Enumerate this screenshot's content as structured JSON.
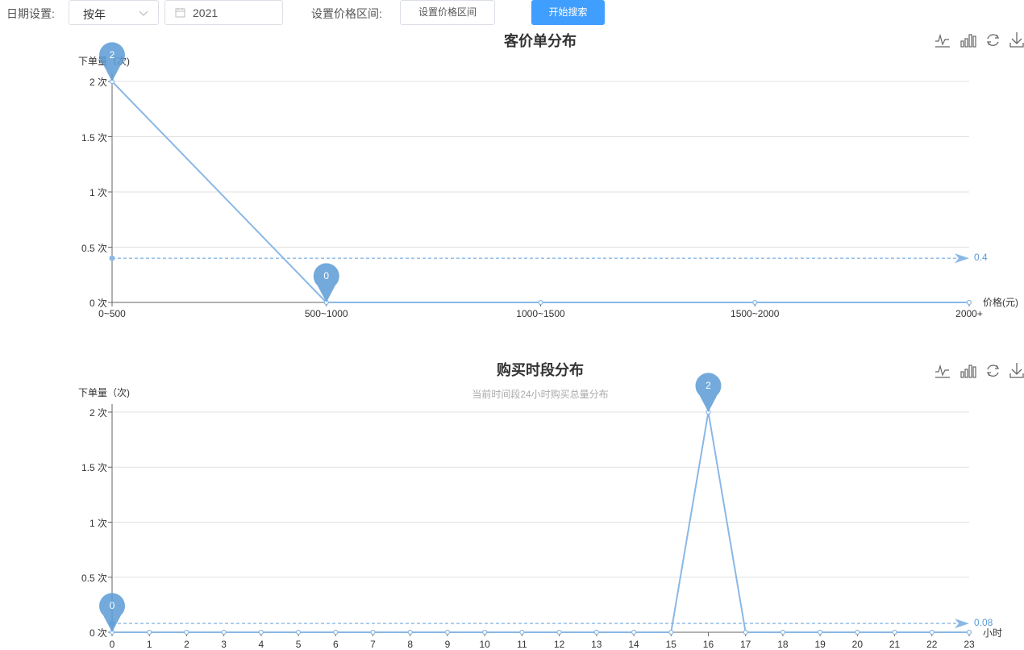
{
  "filters": {
    "date_label": "日期设置:",
    "date_mode": "按年",
    "year": "2021",
    "range_label": "设置价格区间:",
    "range_button": "设置价格区间",
    "search_button": "开始搜索"
  },
  "toolbox": {
    "icons": [
      "line-chart-icon",
      "bar-chart-icon",
      "refresh-icon",
      "download-icon"
    ]
  },
  "colors": {
    "series": "#8ab8e6",
    "marker": "#5b9bd5",
    "primary_button": "#409eff"
  },
  "chart_data": [
    {
      "type": "line",
      "title": "客价单分布",
      "subtitle": "",
      "ylabel": "下单量（次)",
      "xlabel": "价格(元)",
      "categories": [
        "0~500",
        "500~1000",
        "1000~1500",
        "1500~2000",
        "2000+"
      ],
      "values": [
        2,
        0,
        0,
        0,
        0
      ],
      "ylim": [
        0,
        2
      ],
      "y_ticks": [
        "0 次",
        "0.5 次",
        "1 次",
        "1.5 次",
        "2 次"
      ],
      "mark_points": [
        {
          "label": "2",
          "category": "0~500",
          "value": 2
        },
        {
          "label": "0",
          "category": "500~1000",
          "value": 0
        }
      ],
      "mark_line": {
        "label": "0.4",
        "value": 0.4
      },
      "grid": true
    },
    {
      "type": "line",
      "title": "购买时段分布",
      "subtitle": "当前时间段24小时购买总量分布",
      "ylabel": "下单量（次)",
      "xlabel": "小时",
      "categories": [
        "0",
        "1",
        "2",
        "3",
        "4",
        "5",
        "6",
        "7",
        "8",
        "9",
        "10",
        "11",
        "12",
        "13",
        "14",
        "15",
        "16",
        "17",
        "18",
        "19",
        "20",
        "21",
        "22",
        "23"
      ],
      "values": [
        0,
        0,
        0,
        0,
        0,
        0,
        0,
        0,
        0,
        0,
        0,
        0,
        0,
        0,
        0,
        0,
        2,
        0,
        0,
        0,
        0,
        0,
        0,
        0
      ],
      "ylim": [
        0,
        2
      ],
      "y_ticks": [
        "0 次",
        "0.5 次",
        "1 次",
        "1.5 次",
        "2 次"
      ],
      "mark_points": [
        {
          "label": "2",
          "category": "16",
          "value": 2
        },
        {
          "label": "0",
          "category": "0",
          "value": 0
        }
      ],
      "mark_line": {
        "label": "0.08",
        "value": 0.08
      },
      "grid": true
    }
  ]
}
